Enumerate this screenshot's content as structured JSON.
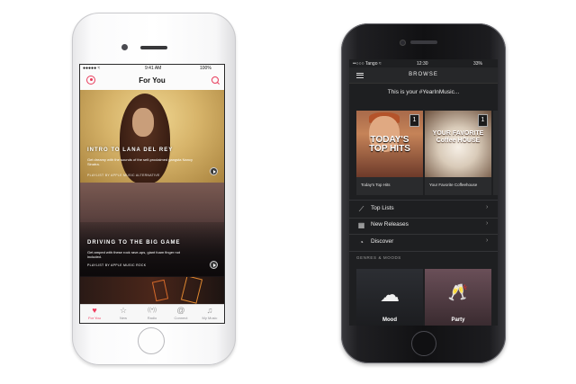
{
  "apple_music": {
    "status": {
      "signal": "●●●●● ≈",
      "time": "9:41 AM",
      "battery": "100%"
    },
    "nav_title": "For You",
    "cards": [
      {
        "title": "INTRO TO LANA DEL REY",
        "description": "Get dreamy with the sounds of the self-proclaimed gangsta Nancy Sinatra.",
        "meta": "PLAYLIST BY APPLE MUSIC ALTERNATIVE"
      },
      {
        "title": "DRIVING TO THE BIG GAME",
        "description": "Get amped with these rock rave-ups, giant foam finger not included.",
        "meta": "PLAYLIST BY APPLE MUSIC ROCK"
      }
    ],
    "tabs": [
      {
        "label": "For You",
        "icon": "heart-icon",
        "glyph": "♥"
      },
      {
        "label": "New",
        "icon": "star-icon",
        "glyph": "☆"
      },
      {
        "label": "Radio",
        "icon": "radio-icon",
        "glyph": "((•))"
      },
      {
        "label": "Connect",
        "icon": "at-icon",
        "glyph": "@"
      },
      {
        "label": "My Music",
        "icon": "music-icon",
        "glyph": "♫"
      }
    ],
    "active_tab_color": "#ef3a5d"
  },
  "spotify": {
    "status": {
      "carrier": "••○○○ Tango ≈",
      "time": "12:30",
      "battery": "33%"
    },
    "nav_title": "BROWSE",
    "banner": "This is your #YearInMusic...",
    "tiles": [
      {
        "art_text": "TODAY'S TOP HITS",
        "caption": "Today's Top Hits",
        "badge": "1"
      },
      {
        "art_text": "YOUR FAVORITE Coffee HOUSE",
        "caption": "Your Favorite Coffeehouse",
        "badge": "1"
      }
    ],
    "list_items": [
      {
        "label": "Top Lists",
        "icon": "chart-icon",
        "glyph": "⟋"
      },
      {
        "label": "New Releases",
        "icon": "calendar-icon",
        "glyph": "▦"
      },
      {
        "label": "Discover",
        "icon": "compass-icon",
        "glyph": "◔"
      }
    ],
    "genres_heading": "GENRES & MOODS",
    "genres": [
      {
        "name": "Mood",
        "glyph": "☁"
      },
      {
        "name": "Party",
        "glyph": "🥂"
      }
    ]
  }
}
